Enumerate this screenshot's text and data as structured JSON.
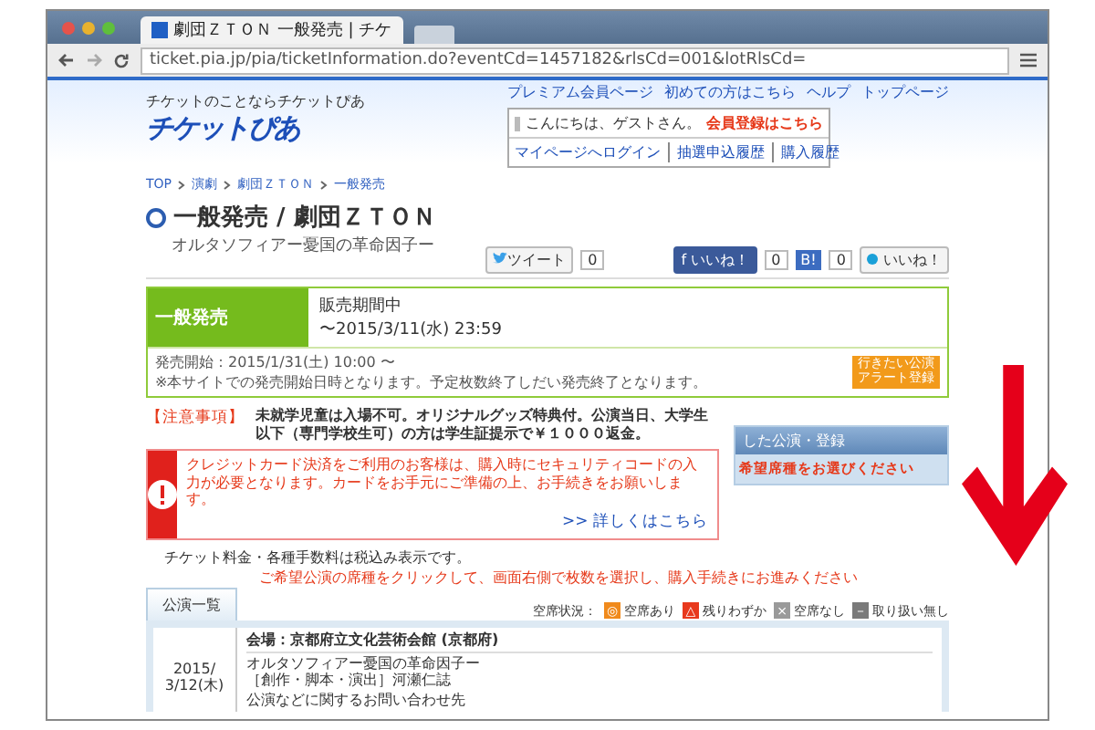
{
  "browser": {
    "tab_title": "劇団ＺＴＯＮ 一般発売 | チケ",
    "url": "ticket.pia.jp/pia/ticketInformation.do?eventCd=1457182&rlsCd=001&lotRlsCd="
  },
  "header": {
    "tagline": "チケットのことならチケットぴあ",
    "logo": "チケットぴあ",
    "top_links": [
      "プレミアム会員ページ",
      "初めての方はこちら",
      "ヘルプ",
      "トップページ"
    ],
    "greeting": "こんにちは、ゲストさん。",
    "register_link": "会員登録はこちら",
    "account_links": [
      "マイページへログイン",
      "抽選申込履歴",
      "購入履歴"
    ]
  },
  "breadcrumb": [
    "TOP",
    "演劇",
    "劇団ＺＴＯＮ",
    "一般発売"
  ],
  "title": "一般発売 / 劇団ＺＴＯＮ",
  "subtitle": "オルタソフィアー憂国の革命因子ー",
  "social": {
    "tweet": "ツイート",
    "tweet_count": "0",
    "like_icon": "f",
    "like": "いいね！",
    "bookmark_label": "B!",
    "like_count": "0",
    "bookmark_count": "0",
    "mixi_like": "いいね！"
  },
  "sale": {
    "label": "一般発売",
    "status": "販売期間中",
    "period": "〜2015/3/11(水) 23:59",
    "start": "発売開始：2015/1/31(土) 10:00 〜",
    "note": "※本サイトでの発売開始日時となります。予定枚数終了しだい発売終了となります。",
    "alert_button": [
      "行きたい公演",
      "アラート登録"
    ]
  },
  "notice": {
    "label": "【注意事項】",
    "text": "未就学児童は入場不可。オリジナルグッズ特典付。公演当日、大学生以下（専門学校生可）の方は学生証提示で￥１０００返金。"
  },
  "side_panel": {
    "header": "した公演・登録",
    "hint": "希望席種をお選びください"
  },
  "credit": {
    "text": "クレジットカード決済をご利用のお客様は、購入時にセキュリティコードの入力が必要となります。カードをお手元にご準備の上、お手続きをお願いします。",
    "link": ">> 詳しくはこちら"
  },
  "tax_note": "チケット料金・各種手数料は税込み表示です。",
  "tabs": [
    {
      "label": "公演一覧",
      "selected": true
    }
  ],
  "instruction": "ご希望公演の席種をクリックして、画面右側で枚数を選択し、購入手続きにお進みください",
  "legend": {
    "label": "空席状況：",
    "items": [
      {
        "symbol": "◎",
        "text": "空席あり",
        "color": "#f08a1c"
      },
      {
        "symbol": "△",
        "text": "残りわずか",
        "color": "#e8391d"
      },
      {
        "symbol": "×",
        "text": "空席なし",
        "color": "#9a9a9a"
      },
      {
        "symbol": "－",
        "text": "取り扱い無し",
        "color": "#7a7a7a"
      }
    ]
  },
  "performance": {
    "date": "2015/",
    "day": "3/12(木)",
    "venue": "会場：京都府立文化芸術会館 (京都府)",
    "title": "オルタソフィアー憂国の革命因子ー",
    "credits": "［創作・脚本・演出］河瀬仁誌",
    "contact": "公演などに関するお問い合わせ先"
  }
}
